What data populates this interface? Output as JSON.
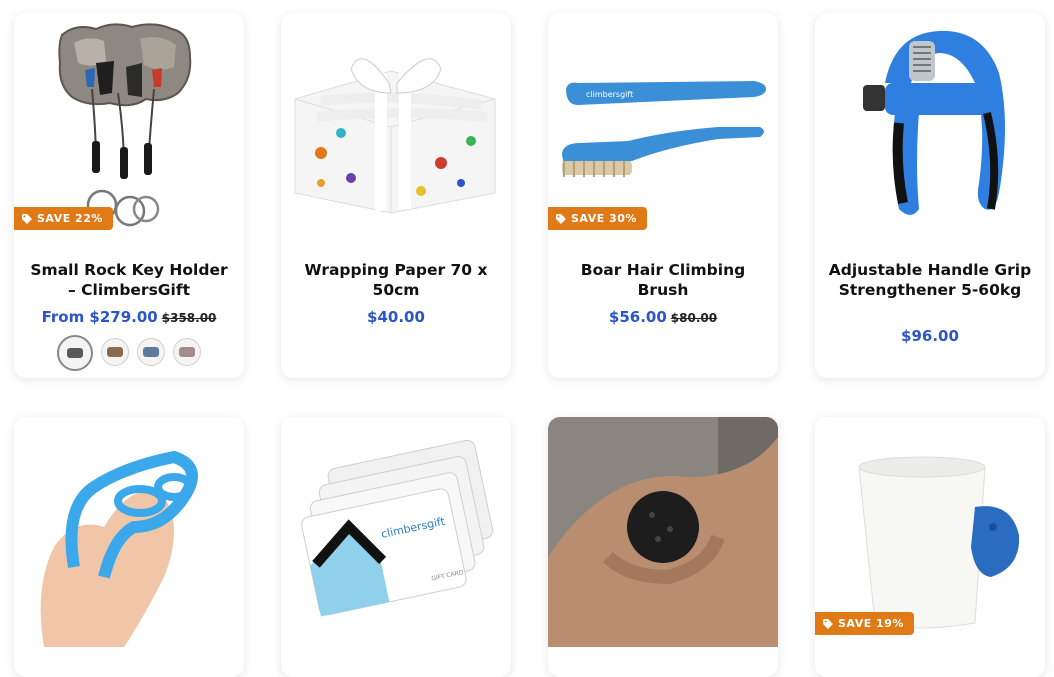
{
  "products": [
    {
      "title": "Small Rock Key Holder – ClimbersGift",
      "price_prefix": "From ",
      "price": "$279.00",
      "compare_price": "$358.00",
      "badge": "SAVE 22%",
      "image": "key-holder",
      "swatch_colors": [
        "#5a5a5a",
        "#8a6a50",
        "#5c7a9e",
        "#a48a8a"
      ]
    },
    {
      "title": "Wrapping Paper 70 x 50cm",
      "price": "$40.00",
      "image": "wrapped-gift"
    },
    {
      "title": "Boar Hair Climbing Brush",
      "price": "$56.00",
      "compare_price": "$80.00",
      "badge": "SAVE 30%",
      "image": "blue-brushes",
      "brand_mark": "climbersgift"
    },
    {
      "title": "Adjustable Handle Grip Strengthener 5-60kg",
      "price": "$96.00",
      "image": "hand-gripper"
    },
    {
      "image": "finger-stretcher"
    },
    {
      "image": "gift-cards",
      "brand_mark": "climbersgift",
      "card_text": "GIFT CARD"
    },
    {
      "image": "grip-ball"
    },
    {
      "image": "mug-with-hold",
      "badge": "SAVE 19%"
    }
  ],
  "colors": {
    "badge": "#e07a16",
    "price": "#2b55c8",
    "title": "#111111"
  }
}
